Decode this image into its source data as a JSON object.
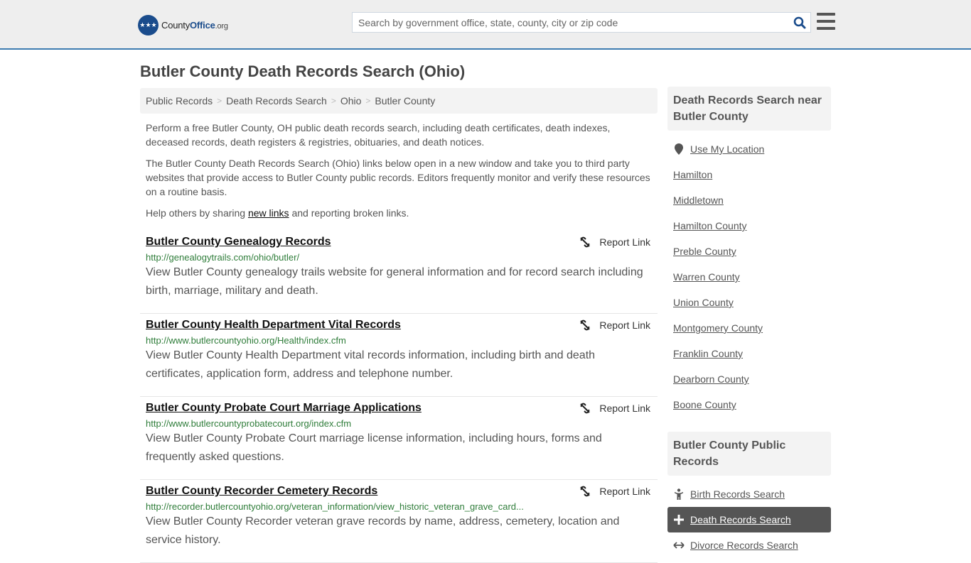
{
  "header": {
    "logo": {
      "prefix": "County",
      "brand": "Office",
      "suffix": ".org"
    },
    "search_placeholder": "Search by government office, state, county, city or zip code",
    "brand_color": "#1a4c8c",
    "accent_border_color": "#3d7bb0"
  },
  "page": {
    "title": "Butler County Death Records Search (Ohio)",
    "breadcrumb": [
      "Public Records",
      "Death Records Search",
      "Ohio",
      "Butler County"
    ],
    "intro_1": "Perform a free Butler County, OH public death records search, including death certificates, death indexes, deceased records, death registers & registries, obituaries, and death notices.",
    "intro_2": "The Butler County Death Records Search (Ohio) links below open in a new window and take you to third party websites that provide access to Butler County public records. Editors frequently monitor and verify these resources on a routine basis.",
    "intro_3_before": "Help others by sharing ",
    "intro_3_link": "new links",
    "intro_3_after": " and reporting broken links."
  },
  "records": [
    {
      "title": "Butler County Genealogy Records",
      "url": "http://genealogytrails.com/ohio/butler/",
      "description": "View Butler County genealogy trails website for general information and for record search including birth, marriage, military and death.",
      "report_label": "Report Link"
    },
    {
      "title": "Butler County Health Department Vital Records",
      "url": "http://www.butlercountyohio.org/Health/index.cfm",
      "description": "View Butler County Health Department vital records information, including birth and death certificates, application form, address and telephone number.",
      "report_label": "Report Link"
    },
    {
      "title": "Butler County Probate Court Marriage Applications",
      "url": "http://www.butlercountyprobatecourt.org/index.cfm",
      "description": "View Butler County Probate Court marriage license information, including hours, forms and frequently asked questions.",
      "report_label": "Report Link"
    },
    {
      "title": "Butler County Recorder Cemetery Records",
      "url": "http://recorder.butlercountyohio.org/veteran_information/view_historic_veteran_grave_card...",
      "description": "View Butler County Recorder veteran grave records by name, address, cemetery, location and service history.",
      "report_label": "Report Link"
    }
  ],
  "sidebar": {
    "nearby_heading": "Death Records Search near Butler County",
    "use_location": "Use My Location",
    "nearby": [
      "Hamilton",
      "Middletown",
      "Hamilton County",
      "Preble County",
      "Warren County",
      "Union County",
      "Montgomery County",
      "Franklin County",
      "Dearborn County",
      "Boone County"
    ],
    "public_heading": "Butler County Public Records",
    "public_records": [
      {
        "label": "Birth Records Search",
        "icon": "child-icon",
        "active": false
      },
      {
        "label": "Death Records Search",
        "icon": "plus-icon",
        "active": true
      },
      {
        "label": "Divorce Records Search",
        "icon": "arrows-horizontal-icon",
        "active": false
      }
    ]
  }
}
